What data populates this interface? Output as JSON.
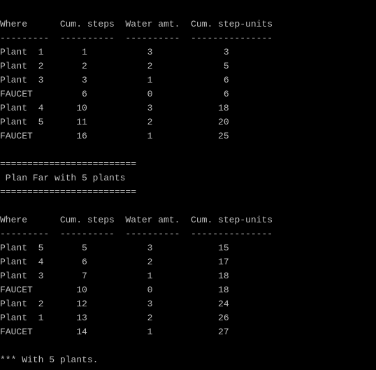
{
  "colors": {
    "background": "#000000",
    "text": "#c0c0c0"
  },
  "console": {
    "lines": [
      "=========================",
      "",
      "Where      Cum. steps  Water amt.  Cum. step-units",
      "---------  ----------  ----------  ---------------",
      "Plant  1       1           3             3",
      "Plant  2       2           2             5",
      "Plant  3       3           1             6",
      "FAUCET         6           0             6",
      "Plant  4      10           3            18",
      "Plant  5      11           2            20",
      "FAUCET        16           1            25",
      "",
      "=========================",
      " Plan Far with 5 plants",
      "=========================",
      "",
      "Where      Cum. steps  Water amt.  Cum. step-units",
      "---------  ----------  ----------  ---------------",
      "Plant  5       5           3            15",
      "Plant  4       6           2            17",
      "Plant  3       7           1            18",
      "FAUCET        10           0            18",
      "Plant  2      12           3            24",
      "Plant  1      13           2            26",
      "FAUCET        14           1            27",
      "",
      "*** With 5 plants."
    ]
  }
}
